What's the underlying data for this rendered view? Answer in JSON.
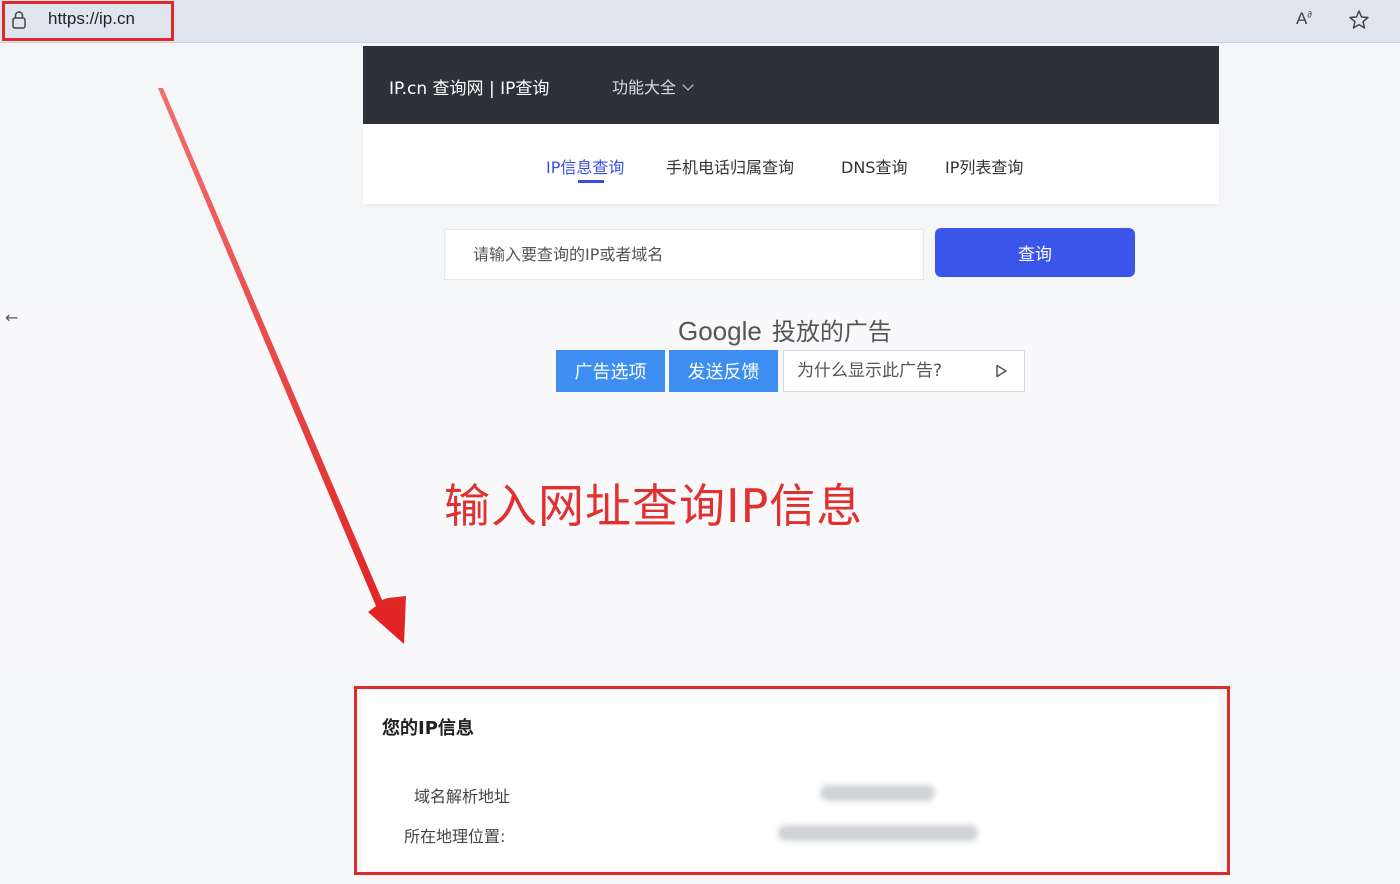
{
  "browser": {
    "url": "https://ip.cn",
    "read_aloud_label": "A",
    "read_aloud_sup": "∂"
  },
  "header": {
    "site_title": "IP.cn 查询网 | IP查询",
    "menu_label": "功能大全"
  },
  "tabs": [
    {
      "label": "IP信息查询",
      "active": true
    },
    {
      "label": "手机电话归属查询",
      "active": false
    },
    {
      "label": "DNS查询",
      "active": false
    },
    {
      "label": "IP列表查询",
      "active": false
    }
  ],
  "search": {
    "placeholder": "请输入要查询的IP或者域名",
    "button_label": "查询"
  },
  "ad": {
    "brand": "Google",
    "title_suffix": "投放的广告",
    "options_label": "广告选项",
    "feedback_label": "发送反馈",
    "why_label": "为什么显示此广告?"
  },
  "annotation": "输入网址查询IP信息",
  "info": {
    "title": "您的IP信息",
    "domain_label": "域名解析地址",
    "location_label": "所在地理位置:"
  },
  "colors": {
    "accent": "#3b55ea",
    "header_bg": "#2c3238",
    "ad_button": "#3d8ef0",
    "annotation_red": "#e03030"
  }
}
